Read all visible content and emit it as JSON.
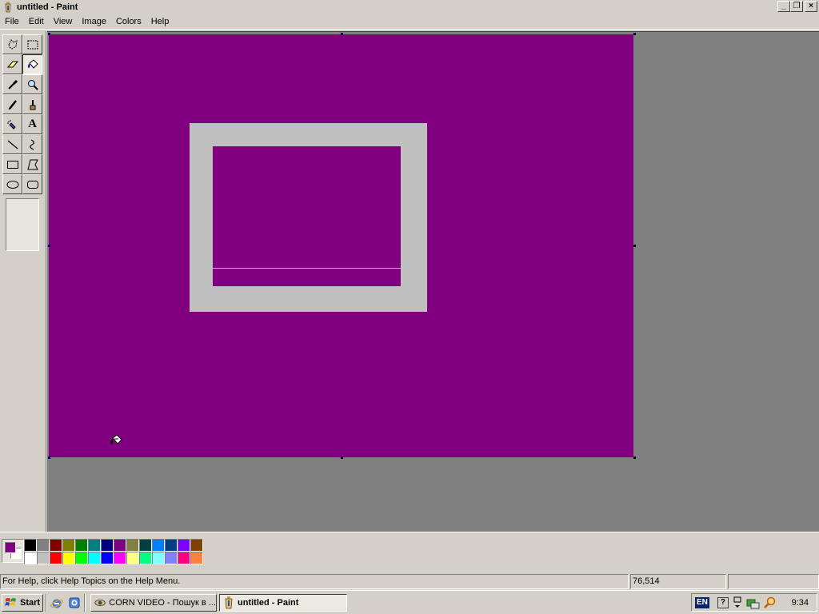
{
  "window": {
    "title": "untitled - Paint",
    "minimize_glyph": "_",
    "restore_glyph": "❐",
    "close_glyph": "×"
  },
  "menubar": {
    "items": [
      {
        "label": "File"
      },
      {
        "label": "Edit"
      },
      {
        "label": "View"
      },
      {
        "label": "Image"
      },
      {
        "label": "Colors"
      },
      {
        "label": "Help"
      }
    ]
  },
  "toolbox": {
    "tools": [
      {
        "name": "free-form-select-tool",
        "icon": "free-form-select-icon"
      },
      {
        "name": "select-tool",
        "icon": "rectangle-select-icon"
      },
      {
        "name": "eraser-tool",
        "icon": "eraser-icon"
      },
      {
        "name": "fill-with-color-tool",
        "icon": "paint-bucket-icon",
        "active": true
      },
      {
        "name": "pick-color-tool",
        "icon": "eyedropper-icon"
      },
      {
        "name": "magnifier-tool",
        "icon": "magnifier-icon"
      },
      {
        "name": "pencil-tool",
        "icon": "pencil-icon"
      },
      {
        "name": "brush-tool",
        "icon": "brush-icon"
      },
      {
        "name": "airbrush-tool",
        "icon": "airbrush-icon"
      },
      {
        "name": "text-tool",
        "icon": "text-icon",
        "glyph": "A"
      },
      {
        "name": "line-tool",
        "icon": "line-icon"
      },
      {
        "name": "curve-tool",
        "icon": "curve-icon"
      },
      {
        "name": "rectangle-tool",
        "icon": "rectangle-icon"
      },
      {
        "name": "polygon-tool",
        "icon": "polygon-icon"
      },
      {
        "name": "ellipse-tool",
        "icon": "ellipse-icon"
      },
      {
        "name": "rounded-rectangle-tool",
        "icon": "rounded-rectangle-icon"
      }
    ]
  },
  "canvas": {
    "background_color": "#800080",
    "frame_color": "#c0c0c0"
  },
  "palette": {
    "foreground": "#800080",
    "background": "#ffffff",
    "top_row": [
      "#000000",
      "#808080",
      "#800000",
      "#808000",
      "#008000",
      "#008080",
      "#000080",
      "#800080",
      "#808040",
      "#004040",
      "#0080ff",
      "#004080",
      "#8000ff",
      "#804000"
    ],
    "bottom_row": [
      "#ffffff",
      "#c0c0c0",
      "#ff0000",
      "#ffff00",
      "#00ff00",
      "#00ffff",
      "#0000ff",
      "#ff00ff",
      "#ffff80",
      "#00ff80",
      "#80ffff",
      "#8080ff",
      "#ff0080",
      "#ff8040"
    ]
  },
  "statusbar": {
    "help_text": "For Help, click Help Topics on the Help Menu.",
    "coordinates": "76,514",
    "size": ""
  },
  "taskbar": {
    "start_label": "Start",
    "tasks": [
      {
        "label": "CORN VIDEO - Пошук в ...",
        "icon": "browser-eye-icon",
        "active": false
      },
      {
        "label": "untitled - Paint",
        "icon": "paint-icon",
        "active": true
      }
    ],
    "tray": {
      "language": "EN",
      "help_glyph": "?",
      "clock": "9:34"
    }
  }
}
